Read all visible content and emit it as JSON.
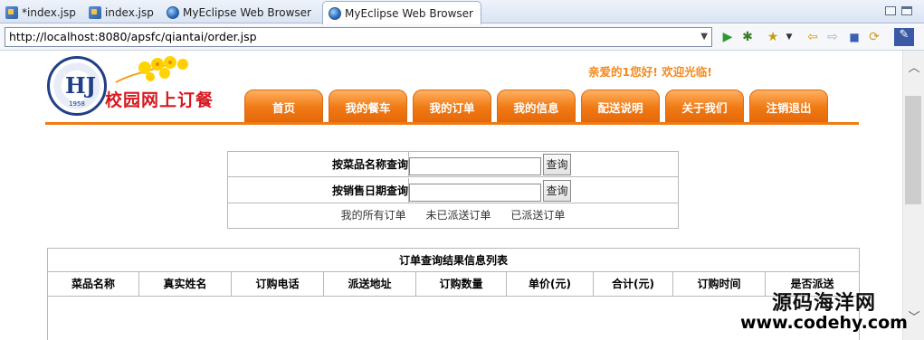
{
  "tabs": [
    {
      "label": "*index.jsp",
      "icon": "jsp-file-icon",
      "active": false
    },
    {
      "label": "index.jsp",
      "icon": "jsp-file-icon",
      "active": false
    },
    {
      "label": "MyEclipse Web Browser",
      "icon": "browser-globe-icon",
      "active": false
    },
    {
      "label": "MyEclipse Web Browser",
      "icon": "browser-globe-icon",
      "active": true
    }
  ],
  "tab_close_glyph": "✕",
  "address": {
    "url": "http://localhost:8080/apsfc/qiantai/order.jsp"
  },
  "toolbar_icons": [
    "go-icon",
    "debug-icon",
    "favorites-icon",
    "back-icon",
    "forward-icon",
    "stop-icon",
    "refresh-icon",
    "eclipse-icon"
  ],
  "site": {
    "title": "校园网上订餐",
    "logo_text": "HJ",
    "logo_year": "1958",
    "welcome": "亲爱的1您好!  欢迎光临!"
  },
  "nav": [
    "首页",
    "我的餐车",
    "我的订单",
    "我的信息",
    "配送说明",
    "关于我们",
    "注销退出"
  ],
  "search": {
    "by_name_label": "按菜品名称查询",
    "by_date_label": "按销售日期查询",
    "button_label": "查询",
    "name_value": "",
    "date_value": "",
    "links": [
      "我的所有订单",
      "未已派送订单",
      "已派送订单"
    ]
  },
  "results": {
    "caption": "订单查询结果信息列表",
    "columns": [
      "菜品名称",
      "真实姓名",
      "订购电话",
      "派送地址",
      "订购数量",
      "单价(元)",
      "合计(元)",
      "订购时间",
      "是否派送"
    ]
  },
  "watermark": {
    "line1": "源码海洋网",
    "line2": "www.codehy.com"
  },
  "colors": {
    "accent_orange": "#f07a14",
    "welcome_orange": "#f28a1e",
    "title_red": "#d8191f"
  }
}
